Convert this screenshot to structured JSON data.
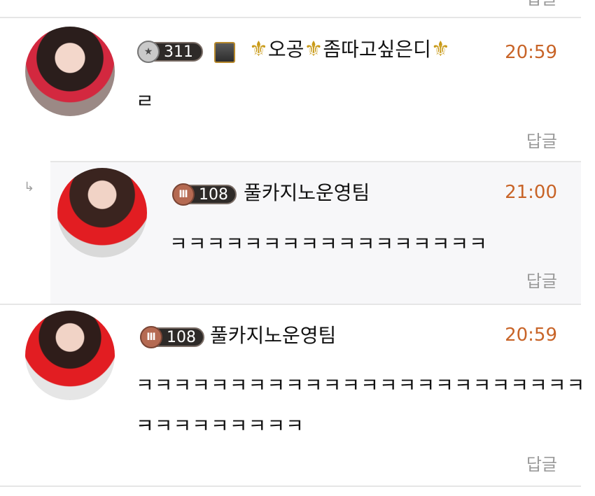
{
  "top": {
    "reply_label": "답글"
  },
  "comments": [
    {
      "nickname_plain": "오공",
      "nickname_mid": "좀따고싶은디",
      "level": "311",
      "time": "20:59",
      "text": "ㄹ",
      "reply_label": "답글"
    },
    {
      "nickname": "풀카지노운영팀",
      "level": "108",
      "time": "21:00",
      "text": "ㅋㅋㅋㅋㅋㅋㅋㅋㅋㅋㅋㅋㅋㅋㅋㅋㅋ",
      "reply_label": "답글"
    },
    {
      "nickname": "풀카지노운영팀",
      "level": "108",
      "time": "20:59",
      "text_line1": "ㅋㅋㅋㅋㅋㅋㅋㅋㅋㅋㅋㅋㅋㅋㅋㅋㅋㅋㅋㅋㅋㅋㅋㅋㅋ",
      "text_line2": "ㅋㅋㅋㅋㅋㅋㅋㅋㅋ",
      "reply_label": "답글"
    }
  ],
  "colors": {
    "time": "#c86428",
    "reply": "#9a9a9a",
    "divider": "#e6e6e6",
    "reply_bg": "#f7f7f9",
    "accent_gold": "#c99a18"
  }
}
